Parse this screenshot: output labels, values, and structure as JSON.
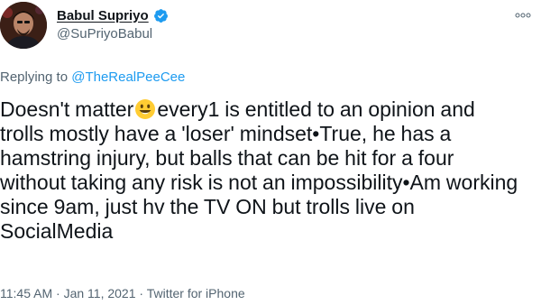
{
  "author": {
    "display_name": "Babul Supriyo",
    "handle": "@SuPriyoBabul"
  },
  "reply": {
    "prefix": "Replying to",
    "mention": "@TheRealPeeCee"
  },
  "tweet": {
    "text_part1": "Doesn't matter",
    "emoji": "smiling-face-icon",
    "text_part2": "every1 is entitled to an opinion and trolls mostly have a 'loser' mindset•True, he has a hamstring injury, but balls that can be hit for a four without taking any risk is not an impossibility•Am working since 9am, just hv the TV ON but trolls live on SocialMedia"
  },
  "meta": {
    "time": "11:45 AM",
    "separator1": " · ",
    "date": "Jan 11, 2021",
    "separator2": " · ",
    "source": "Twitter for iPhone"
  },
  "colors": {
    "accent": "#1d9bf0",
    "secondary_text": "#536471",
    "primary_text": "#0f1419"
  }
}
